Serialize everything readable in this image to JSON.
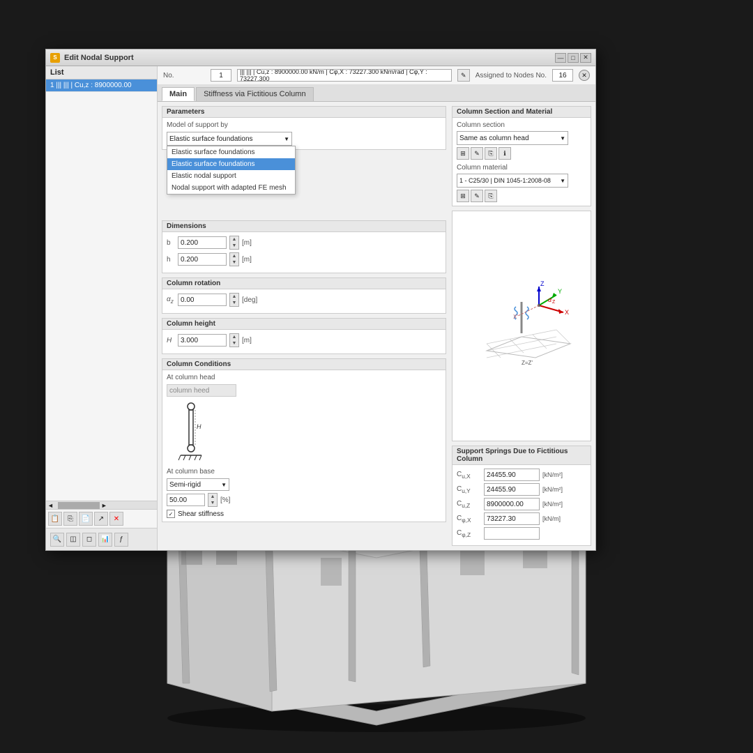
{
  "app": {
    "title": "Edit Nodal Support",
    "background_color": "#1a1a1a"
  },
  "titlebar": {
    "title": "Edit Nodal Support",
    "minimize": "—",
    "maximize": "□",
    "close": "✕"
  },
  "list": {
    "panel_title": "List",
    "items": [
      {
        "id": "1",
        "label": "1  |||  |||  | Cu,z : 8900000.00"
      }
    ]
  },
  "no_name_row": {
    "no_label": "No.",
    "no_value": "1",
    "name_value": "|||  |||  | Cu,z : 8900000.00 kN/m | Cφ,X : 73227.300 kNm/rad | Cφ,Y : 73227.300",
    "assigned_label": "Assigned to Nodes No.",
    "assigned_value": "16"
  },
  "tabs": {
    "main_label": "Main",
    "stiffness_label": "Stiffness via Fictitious Column"
  },
  "parameters": {
    "section_title": "Parameters",
    "model_label": "Model of support by",
    "selected_option": "Elastic surface foundations",
    "dropdown_options": [
      "Elastic surface foundations",
      "Elastic surface foundations",
      "Elastic nodal support",
      "Nodal support with adapted FE mesh"
    ],
    "active_option_index": 1
  },
  "dimensions": {
    "section_title": "Dimensions",
    "b_label": "b",
    "b_value": "0.200",
    "b_unit": "[m]",
    "h_label": "h",
    "h_value": "0.200",
    "h_unit": "[m]"
  },
  "column_rotation": {
    "section_title": "Column rotation",
    "alpha_label": "αz",
    "alpha_value": "0.00",
    "alpha_unit": "[deg]"
  },
  "column_height": {
    "section_title": "Column height",
    "H_label": "H",
    "H_value": "3.000",
    "H_unit": "[m]"
  },
  "column_conditions": {
    "section_title": "Column Conditions",
    "head_label": "At column head",
    "head_value": "column heed",
    "base_label": "At column base",
    "base_value": "Semi-rigid",
    "base_percent": "50.00",
    "base_percent_unit": "[%]",
    "shear_label": "Shear stiffness"
  },
  "column_section": {
    "section_title": "Column Section and Material",
    "section_label": "Column section",
    "section_value": "Same as column head",
    "material_label": "Column material",
    "material_value": "1 - C25/30 | DIN 1045-1:2008-08"
  },
  "support_springs": {
    "section_title": "Support Springs Due to Fictitious Column",
    "springs": [
      {
        "label": "Cu,X",
        "value": "24455.90",
        "unit": "[kN/m²]"
      },
      {
        "label": "Cu,Y",
        "value": "24455.90",
        "unit": "[kN/m²]"
      },
      {
        "label": "Cu,Z",
        "value": "8900000.00",
        "unit": "[kN/m²]"
      },
      {
        "label": "Cφ,X",
        "value": "73227.30",
        "unit": "[kN/m]"
      },
      {
        "label": "Cφ,Z",
        "value": "",
        "unit": ""
      }
    ]
  },
  "toolbar_bottom": {
    "buttons": [
      "📋",
      "💾",
      "↩",
      "↪",
      "✕",
      "🔍",
      "◫",
      "◻",
      "📊",
      "ƒ"
    ]
  }
}
